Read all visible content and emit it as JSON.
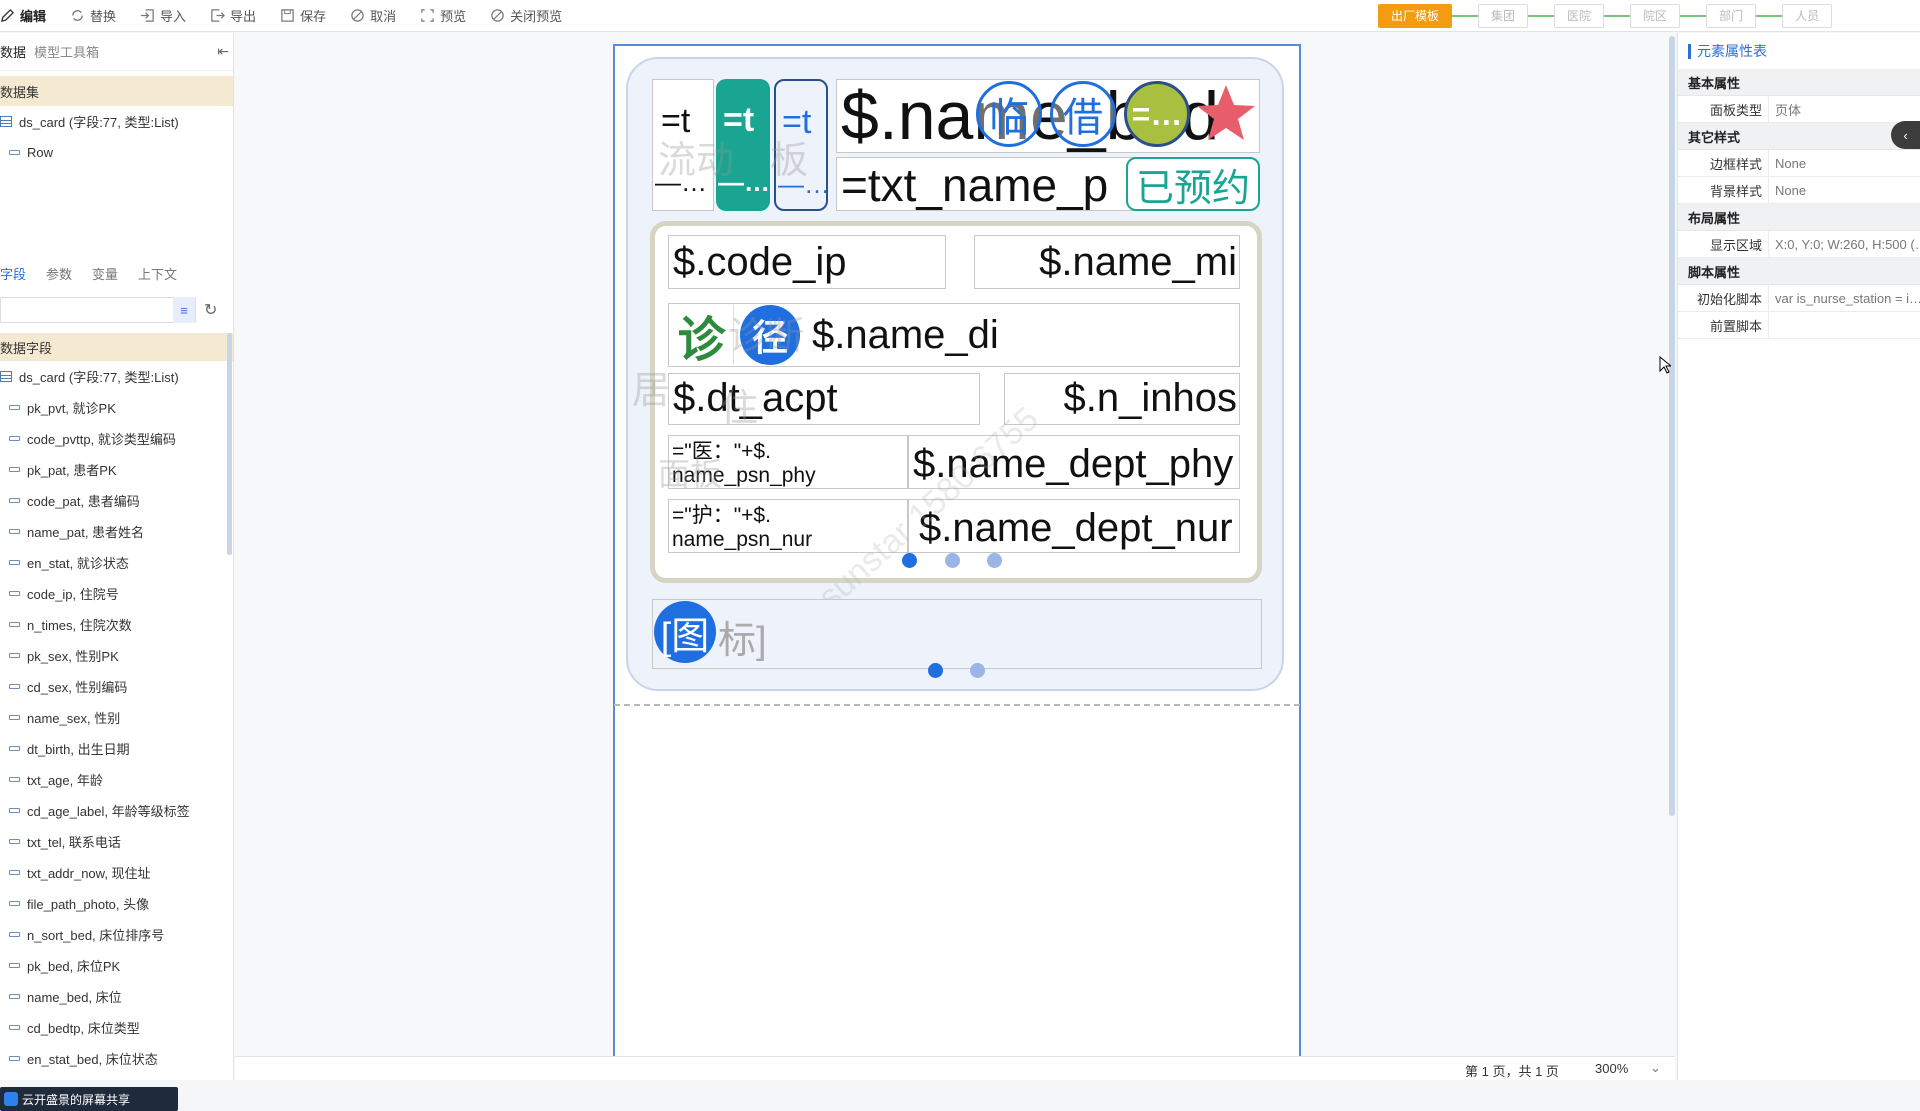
{
  "toolbar": {
    "edit": "编辑",
    "replace": "替换",
    "import": "导入",
    "export": "导出",
    "save": "保存",
    "cancel": "取消",
    "preview": "预览",
    "close_preview": "关闭预览"
  },
  "levels": [
    "出厂模板",
    "集团",
    "医院",
    "院区",
    "部门",
    "人员"
  ],
  "left": {
    "tab_data": "数据",
    "tab_toolbox": "模型工具箱",
    "dataset_header": "数据集",
    "dataset_name": "ds_card (字段:77, 类型:List)",
    "dataset_child": "Row",
    "subtabs": [
      "字段",
      "参数",
      "变量",
      "上下文"
    ],
    "fields_header": "数据字段",
    "fields_root": "ds_card (字段:77, 类型:List)",
    "fields": [
      "pk_pvt, 就诊PK",
      "code_pvttp, 就诊类型编码",
      "pk_pat, 患者PK",
      "code_pat, 患者编码",
      "name_pat, 患者姓名",
      "en_stat, 就诊状态",
      "code_ip, 住院号",
      "n_times, 住院次数",
      "pk_sex, 性别PK",
      "cd_sex, 性别编码",
      "name_sex, 性别",
      "dt_birth, 出生日期",
      "txt_age, 年龄",
      "cd_age_label, 年龄等级标签",
      "txt_tel, 联系电话",
      "txt_addr_now, 现住址",
      "file_path_photo, 头像",
      "n_sort_bed, 床位排序号",
      "pk_bed, 床位PK",
      "name_bed, 床位",
      "cd_bedtp, 床位类型",
      "en_stat_bed, 床位状态"
    ],
    "share_badge": "云开盛景的屏幕共享"
  },
  "card": {
    "eq1": "=t",
    "eq1_b": "—…",
    "eq2": "=t",
    "eq2_b": "—…",
    "eq3": "=t",
    "eq3_b": "—…",
    "name_bed": "$.name_bed",
    "badge_lin": "临",
    "badge_jie": "借",
    "badge_eq": "=…",
    "txt_name_p": "=txt_name_p",
    "reserved": "已预约",
    "code_ip": "$.code_ip",
    "name_mi": "$.name_mi",
    "icon_zhen": "诊",
    "icon_jing": "径",
    "name_di": "$.name_di",
    "dt_acpt": "$.dt_acpt",
    "n_inhos": "$.n_inhos",
    "doc_expr_1": "=\"医：\"+$.",
    "doc_expr_2": "name_psn_phy",
    "name_dept_phy": "$.name_dept_phy",
    "nur_expr_1": "=\"护：\"+$.",
    "nur_expr_2": "name_psn_nur",
    "name_dept_nur": "$.name_dept_nur",
    "icon_tu": "[图",
    "icon_tu_tail": "标]",
    "wm1": "流动",
    "wm2": "板",
    "wm3": "诊断",
    "wm4": "居",
    "wm5": "住",
    "wm6": "面板",
    "wm_diag": "sunstar 1580 6755"
  },
  "props": {
    "title": "元素属性表",
    "groups": [
      {
        "name": "基本属性",
        "rows": [
          {
            "k": "面板类型",
            "v": "页体"
          }
        ]
      },
      {
        "name": "其它样式",
        "rows": [
          {
            "k": "边框样式",
            "v": "None"
          },
          {
            "k": "背景样式",
            "v": "None"
          }
        ]
      },
      {
        "name": "布局属性",
        "rows": [
          {
            "k": "显示区域",
            "v": "X:0, Y:0;  W:260, H:500 (…"
          }
        ]
      },
      {
        "name": "脚本属性",
        "rows": [
          {
            "k": "初始化脚本",
            "v": "var is_nurse_station = i…"
          },
          {
            "k": "前置脚本",
            "v": ""
          }
        ]
      }
    ]
  },
  "status": {
    "page": "第 1 页，共 1 页",
    "zoom": "300%"
  },
  "colors": {
    "accent": "#2b6fd6",
    "orange": "#f39c12",
    "teal": "#1aa592",
    "blue_circle": "#1f6fe0",
    "olive": "#a9bf3f",
    "star": "#e85d6a"
  }
}
